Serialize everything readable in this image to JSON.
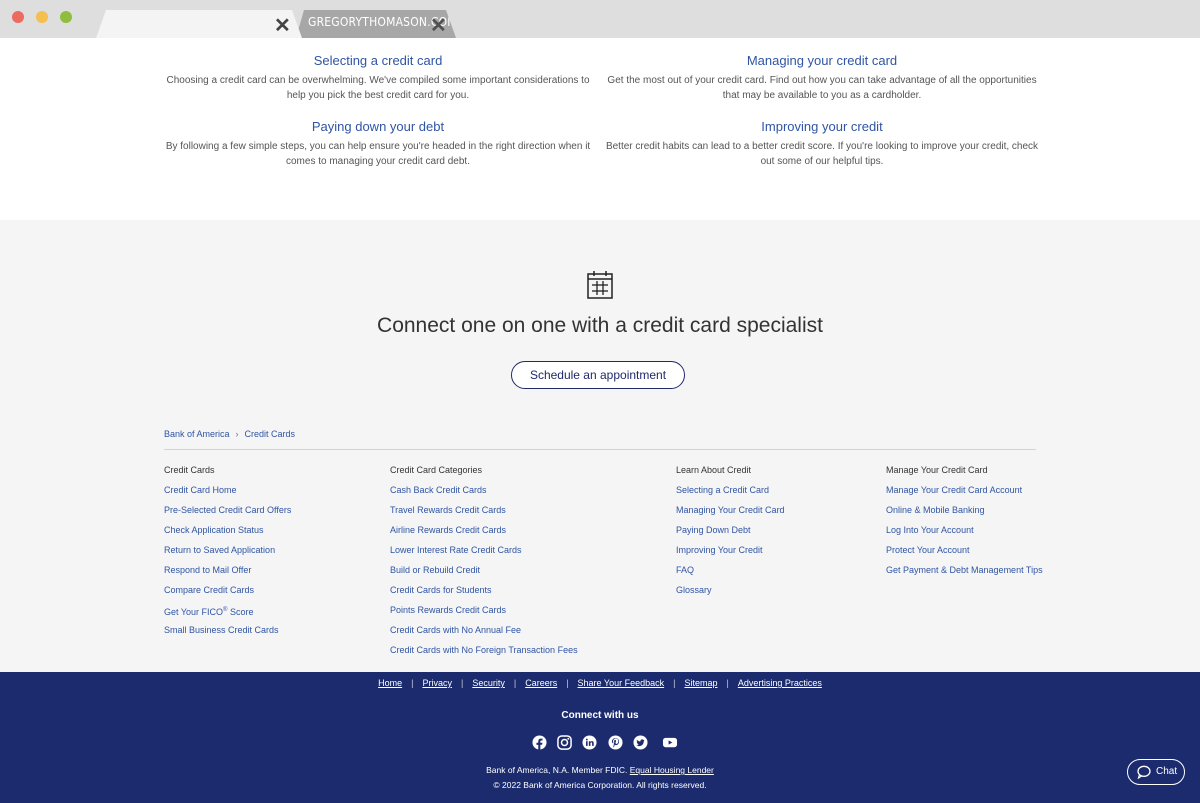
{
  "browser": {
    "tab_title": "GREGORYTHOMASON.COM"
  },
  "articles": [
    {
      "title": "Selecting a credit card",
      "text": "Choosing a credit card can be overwhelming. We've compiled some important considerations to help you pick the best credit card for you."
    },
    {
      "title": "Managing your credit card",
      "text": "Get the most out of your credit card. Find out how you can take advantage of all the opportunities that may be available to you as a cardholder."
    },
    {
      "title": "Paying down your debt",
      "text": "By following a few simple steps, you can help ensure you're headed in the right direction when it comes to managing your credit card debt."
    },
    {
      "title": "Improving your credit",
      "text": "Better credit habits can lead to a better credit score. If you're looking to improve your credit, check out some of our helpful tips."
    }
  ],
  "connect": {
    "title": "Connect one on one with a credit card specialist",
    "button": "Schedule an appointment"
  },
  "breadcrumb": {
    "home": "Bank of America",
    "separator": "›",
    "current": "Credit Cards"
  },
  "footer_columns": [
    {
      "title": "Credit Cards",
      "links": [
        "Credit Card Home",
        "Pre-Selected Credit Card Offers",
        "Check Application Status",
        "Return to Saved Application",
        "Respond to Mail Offer",
        "Compare Credit Cards",
        "Get Your FICO",
        "Small Business Credit Cards"
      ],
      "fico_suffix": "®",
      "fico_tail": " Score"
    },
    {
      "title": "Credit Card Categories",
      "links": [
        "Cash Back Credit Cards",
        "Travel Rewards Credit Cards",
        "Airline Rewards Credit Cards",
        "Lower Interest Rate Credit Cards",
        "Build or Rebuild Credit",
        "Credit Cards for Students",
        "Points Rewards Credit Cards",
        "Credit Cards with No Annual Fee",
        "Credit Cards with No Foreign Transaction Fees"
      ]
    },
    {
      "title": "Learn About Credit",
      "links": [
        "Selecting a Credit Card",
        "Managing Your Credit Card",
        "Paying Down Debt",
        "Improving Your Credit",
        "FAQ",
        "Glossary"
      ]
    },
    {
      "title": "Manage Your Credit Card",
      "links": [
        "Manage Your Credit Card Account",
        "Online & Mobile Banking",
        "Log Into Your Account",
        "Protect Your Account",
        "Get Payment & Debt Management Tips"
      ]
    }
  ],
  "footer": {
    "links": [
      "Home",
      "Privacy",
      "Security",
      "Careers",
      "Share Your Feedback",
      "Sitemap",
      "Advertising Practices"
    ],
    "separator": "|",
    "connect_label": "Connect with us",
    "socials": [
      "facebook-icon",
      "instagram-icon",
      "linkedin-icon",
      "pinterest-icon",
      "twitter-icon",
      "youtube-icon"
    ],
    "legal_line1": "Bank of America, N.A. Member FDIC.",
    "legal_link": "Equal Housing Lender",
    "legal_line2": "© 2022 Bank of America Corporation. All rights reserved.",
    "chat": "Chat"
  },
  "colors": {
    "link": "#2f55a4",
    "footer_bg": "#1b2b6d",
    "button_border": "#1f2a6b"
  }
}
